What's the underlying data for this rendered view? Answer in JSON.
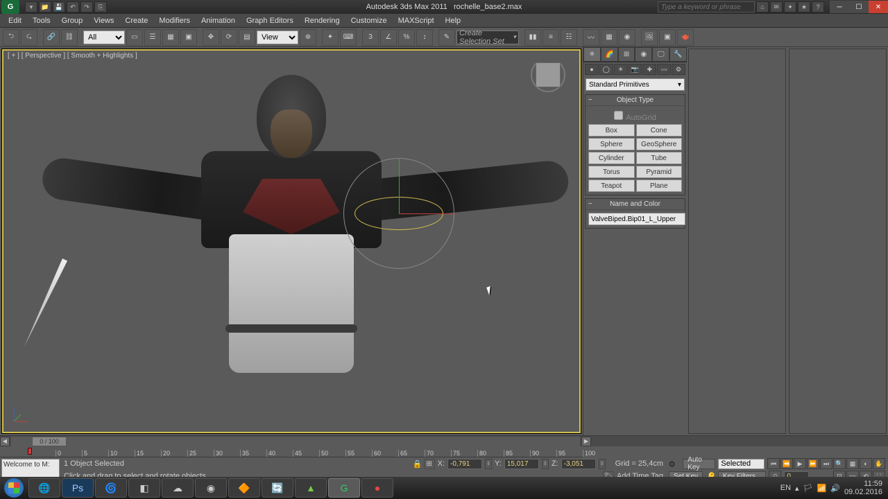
{
  "app": {
    "title": "Autodesk 3ds Max  2011",
    "file": "rochelle_base2.max"
  },
  "search_placeholder": "Type a keyword or phrase",
  "menus": [
    "Edit",
    "Tools",
    "Group",
    "Views",
    "Create",
    "Modifiers",
    "Animation",
    "Graph Editors",
    "Rendering",
    "Customize",
    "MAXScript",
    "Help"
  ],
  "toolbar": {
    "filter_all": "All",
    "ref_mode": "View",
    "selset": "Create Selection Set"
  },
  "viewport": {
    "label": "[ + ] [ Perspective ] [ Smooth + Highlights ]"
  },
  "command_panel": {
    "dropdown": "Standard Primitives",
    "rollout_objtype": "Object Type",
    "autogrid": "AutoGrid",
    "primitives": [
      "Box",
      "Cone",
      "Sphere",
      "GeoSphere",
      "Cylinder",
      "Tube",
      "Torus",
      "Pyramid",
      "Teapot",
      "Plane"
    ],
    "rollout_name": "Name and Color",
    "object_name": "ValveBiped.Bip01_L_Upper"
  },
  "timeline": {
    "handle": "0 / 100",
    "ticks": [
      "0",
      "5",
      "10",
      "15",
      "20",
      "25",
      "30",
      "35",
      "40",
      "45",
      "50",
      "55",
      "60",
      "65",
      "70",
      "75",
      "80",
      "85",
      "90",
      "95",
      "100"
    ]
  },
  "status": {
    "welcome": "Welcome to M:",
    "selection": "1 Object Selected",
    "prompt": "Click and drag to select and rotate objects",
    "x": "-0,791",
    "y": "15,017",
    "z": "-3,051",
    "grid": "Grid = 25,4cm",
    "add_time_tag": "Add Time Tag",
    "auto_key": "Auto Key",
    "set_key": "Set Key",
    "key_mode": "Selected",
    "key_filters": "Key Filters...",
    "frame": "0"
  },
  "tray": {
    "lang": "EN",
    "time": "11:59",
    "date": "09.02.2016"
  }
}
